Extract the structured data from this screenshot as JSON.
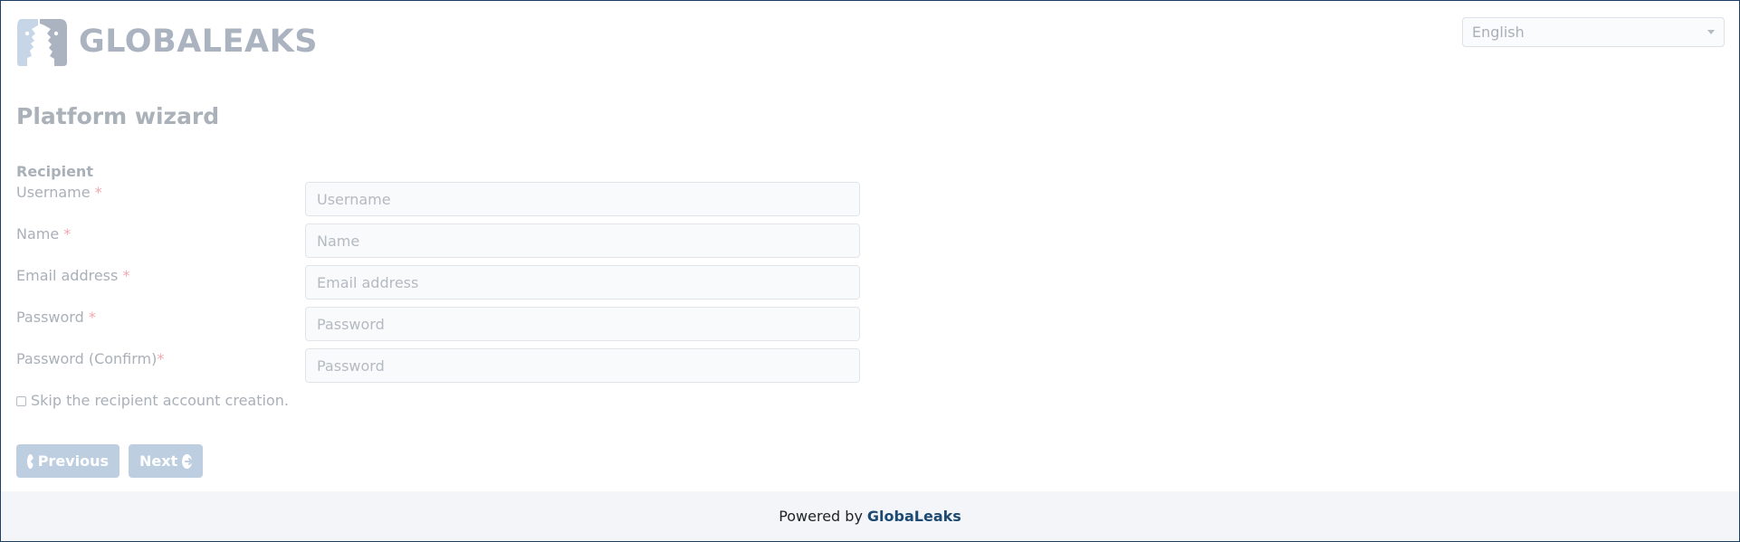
{
  "header": {
    "logo_text": "GLOBALEAKS",
    "logo_icon": "globaleaks-faces-icon",
    "language": {
      "selected": "English"
    }
  },
  "page_title": "Platform wizard",
  "form": {
    "section_label": "Recipient",
    "required_marker": "*",
    "fields": [
      {
        "label": "Username",
        "placeholder": "Username"
      },
      {
        "label": "Name",
        "placeholder": "Name"
      },
      {
        "label": "Email address",
        "placeholder": "Email address"
      },
      {
        "label": "Password",
        "placeholder": "Password"
      },
      {
        "label": "Password (Confirm)",
        "placeholder": "Password"
      }
    ],
    "skip_label": "Skip the recipient account creation.",
    "skip_checked": false
  },
  "buttons": {
    "previous": "Previous",
    "previous_icon": "arrow-circle-left-icon",
    "next": "Next",
    "next_icon": "arrow-circle-right-icon"
  },
  "footer": {
    "text": "Powered by",
    "link": "GlobaLeaks"
  },
  "colors": {
    "accent": "#1c4a73",
    "button": "#bccedf",
    "required": "#f0a7ae",
    "muted_text": "#a9b0b8",
    "footer_bg": "#f3f5f8"
  }
}
